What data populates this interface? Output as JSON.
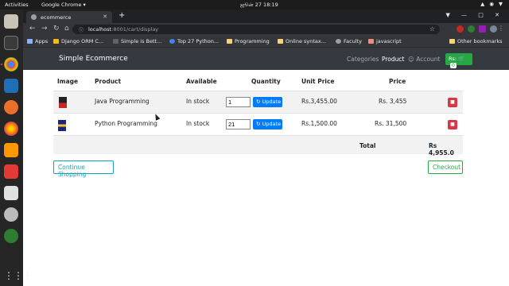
{
  "os": {
    "activities_label": "Activities",
    "app_label": "Google Chrome ▾",
    "clock": "ஜூன் 27  18:19",
    "tray": "▲ ◉ ▼"
  },
  "browser": {
    "tab_title": "ecommerce",
    "url_host": "localhost",
    "url_path": ":8001/cart/display",
    "bookmarks": [
      {
        "label": "Apps",
        "color": "#8ab4f8"
      },
      {
        "label": "Django ORM C...",
        "color": "#fbbc04"
      },
      {
        "label": "Simple is Bett...",
        "color": "#5f6368"
      },
      {
        "label": "Top 27 Python...",
        "color": "#4285f4"
      },
      {
        "label": "Programming",
        "color": "#fdd663"
      },
      {
        "label": "Online syntax...",
        "color": "#fdd663"
      },
      {
        "label": "Faculty",
        "color": "#9aa0a6"
      },
      {
        "label": "javascript",
        "color": "#f28b82"
      },
      {
        "label": "Other bookmarks",
        "color": "#fdd663"
      }
    ]
  },
  "site": {
    "brand": "Simple Ecommerce",
    "nav": {
      "categories": "Categories",
      "product": "Product",
      "account": "☺ Account"
    },
    "cart_button": {
      "currency": "Rs:",
      "icon": "cart-icon",
      "count": "0"
    }
  },
  "cart": {
    "headers": {
      "image": "Image",
      "product": "Product",
      "available": "Available",
      "quantity": "Quantity",
      "unit_price": "Unit Price",
      "price": "Price"
    },
    "items": [
      {
        "product": "Java Programming",
        "available": "In stock",
        "quantity": "1",
        "unit_price": "Rs.3,455.00",
        "price": "Rs. 3,455",
        "update_label": "Update"
      },
      {
        "product": "Python Programming",
        "available": "In stock",
        "quantity": "21",
        "unit_price": "Rs.1,500.00",
        "price": "Rs. 31,500",
        "update_label": "Update"
      }
    ],
    "total_label": "Total",
    "total_value": "Rs 4,955.0",
    "continue_label": "Continue Shopping",
    "checkout_label": "Checkout"
  },
  "colors": {
    "navbar": "#343a40",
    "success": "#28a745",
    "primary": "#007bff",
    "danger": "#dc3545",
    "info": "#17a2b8"
  }
}
